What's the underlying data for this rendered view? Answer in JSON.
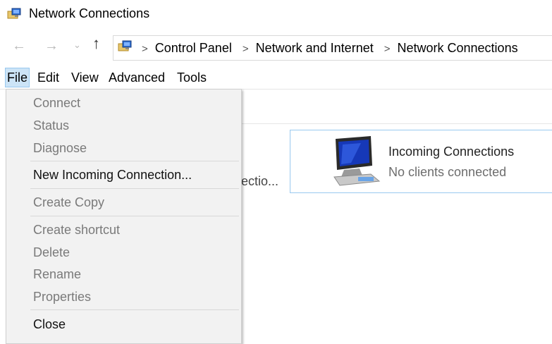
{
  "window": {
    "title": "Network Connections"
  },
  "navigation": {
    "breadcrumbs": [
      "Control Panel",
      "Network and Internet",
      "Network Connections"
    ]
  },
  "menubar": {
    "file": "File",
    "edit": "Edit",
    "view": "View",
    "advanced": "Advanced",
    "tools": "Tools"
  },
  "file_menu": {
    "items": [
      {
        "label": "Connect",
        "enabled": false
      },
      {
        "label": "Status",
        "enabled": false
      },
      {
        "label": "Diagnose",
        "enabled": false
      },
      {
        "label": "New Incoming Connection...",
        "enabled": true
      },
      {
        "label": "Create Copy",
        "enabled": false
      },
      {
        "label": "Create shortcut",
        "enabled": false
      },
      {
        "label": "Delete",
        "enabled": false
      },
      {
        "label": "Rename",
        "enabled": false
      },
      {
        "label": "Properties",
        "enabled": false
      },
      {
        "label": "Close",
        "enabled": true
      }
    ]
  },
  "background": {
    "truncated_text": "ectio..."
  },
  "connection": {
    "name": "Incoming Connections",
    "status": "No clients connected"
  },
  "colors": {
    "menu_highlight": "#cce4f7",
    "selection_border": "#99c9ef",
    "disabled_text": "#7a7a7a"
  },
  "icons": [
    "network-connections-icon",
    "back-arrow-icon",
    "forward-arrow-icon",
    "recent-locations-icon",
    "up-arrow-icon",
    "chevron-right-icon",
    "computer-monitor-icon"
  ]
}
